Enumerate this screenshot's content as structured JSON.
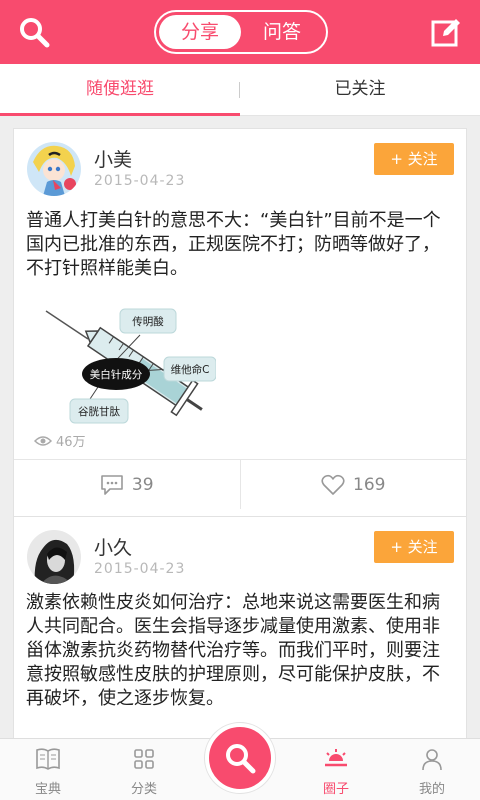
{
  "header": {
    "segments": [
      "分享",
      "问答"
    ],
    "active_segment": 0,
    "search_icon": "search-icon",
    "edit_icon": "edit-icon"
  },
  "tabs": [
    {
      "label": "随便逛逛",
      "active": true
    },
    {
      "label": "已关注",
      "active": false
    }
  ],
  "posts": [
    {
      "user": "小美",
      "date": "2015-04-23",
      "follow_label": "+ 关注",
      "text": "普通人打美白针的意思不大：“美白针”目前不是一个国内已批准的东西，正规医院不打；防晒等做好了，不打针照样能美白。",
      "image_labels": [
        "传明酸",
        "美白针成分",
        "维他命C",
        "谷胱甘肽"
      ],
      "views": "46万",
      "comments": "39",
      "likes": "169"
    },
    {
      "user": "小久",
      "date": "2015-04-23",
      "follow_label": "+ 关注",
      "text": "激素依赖性皮炎如何治疗：总地来说这需要医生和病人共同配合。医生会指导逐步减量使用激素、使用非甾体激素抗炎药物替代治疗等。而我们平时，则要注意按照敏感性皮肤的护理原则，尽可能保护皮肤，不再破坏，使之逐步恢复。"
    }
  ],
  "bottom_nav": [
    {
      "label": "宝典",
      "icon": "book-icon",
      "active": false
    },
    {
      "label": "分类",
      "icon": "grid-icon",
      "active": false
    },
    {
      "label": "圈子",
      "icon": "sun-icon",
      "active": true
    },
    {
      "label": "我的",
      "icon": "person-icon",
      "active": false
    }
  ],
  "colors": {
    "brand": "#f84b6e",
    "follow": "#fba53a"
  }
}
